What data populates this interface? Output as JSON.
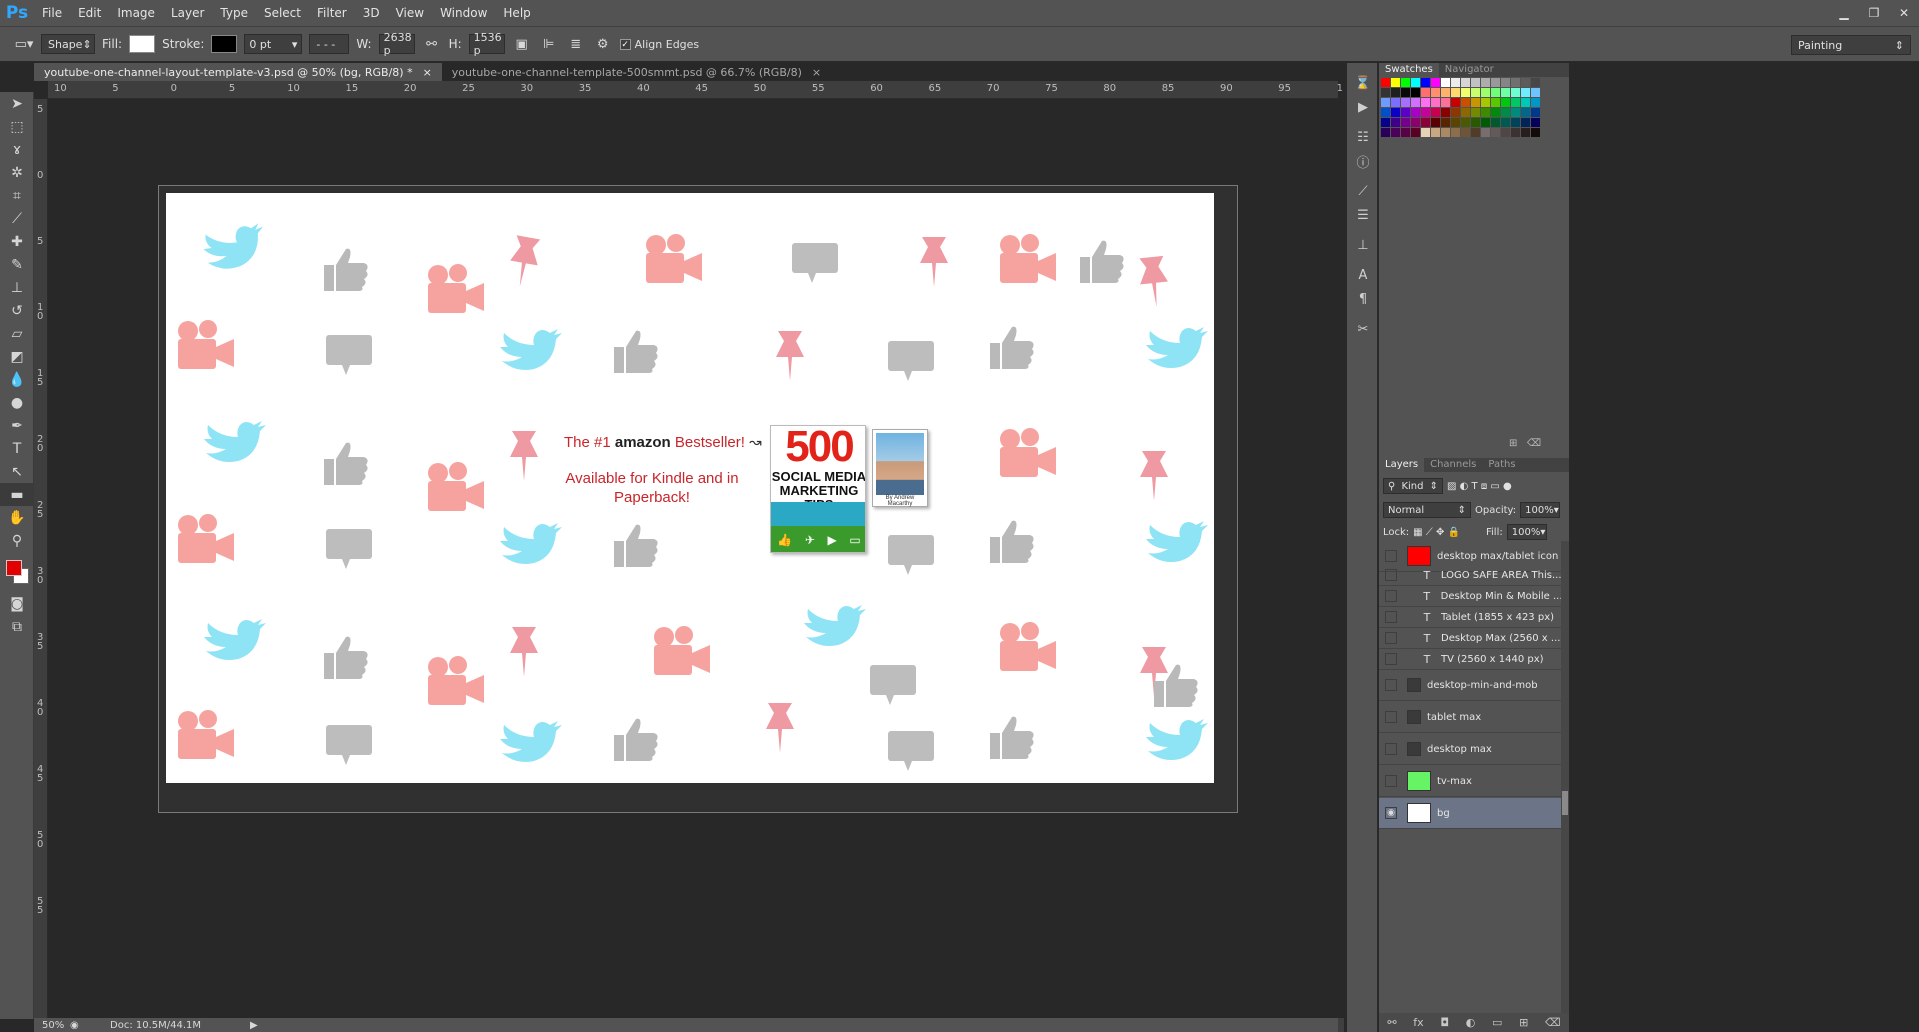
{
  "app": {
    "logo": "Ps"
  },
  "menu": [
    "File",
    "Edit",
    "Image",
    "Layer",
    "Type",
    "Select",
    "Filter",
    "3D",
    "View",
    "Window",
    "Help"
  ],
  "window_controls": {
    "minimize": "▁",
    "restore": "❐",
    "close": "✕"
  },
  "options": {
    "mode": "Shape",
    "fill_label": "Fill:",
    "fill_color": "#ffffff",
    "stroke_label": "Stroke:",
    "stroke_color": "#000000",
    "stroke_width": "0 pt",
    "w_label": "W:",
    "w_value": "2638 p",
    "h_label": "H:",
    "h_value": "1536 p",
    "align_edges_label": "Align Edges",
    "align_edges_checked": true,
    "workspace": "Painting"
  },
  "tabs": [
    {
      "label": "youtube-one-channel-layout-template-v3.psd @ 50% (bg, RGB/8) *",
      "close": "×",
      "active": true
    },
    {
      "label": "youtube-one-channel-template-500smmt.psd @ 66.7% (RGB/8)",
      "close": "×",
      "active": false
    }
  ],
  "ruler_h": [
    "10",
    "5",
    "0",
    "5",
    "10",
    "15",
    "20",
    "25",
    "30",
    "35",
    "40",
    "45",
    "50",
    "55",
    "60",
    "65",
    "70",
    "75",
    "80",
    "85",
    "90",
    "95",
    "1"
  ],
  "ruler_v": [
    "5",
    "0",
    "5",
    "1 0",
    "1 5",
    "2 0",
    "2 5",
    "3 0",
    "3 5",
    "4 0",
    "4 5",
    "5 0",
    "5 5"
  ],
  "canvas": {
    "promo_prefix": "The #1",
    "promo_amazon": "amazon",
    "promo_suffix": "Bestseller!",
    "promo_line2": "Available for Kindle and in Paperback!",
    "book_number": "500",
    "book_title": "SOCIAL MEDIA MARKETING TIPS",
    "author_caption": "By Andrew Macarthy",
    "colors": {
      "twitter": "#8ee3f5",
      "camera": "#f6a3a0",
      "pin": "#ef9aa2",
      "thumb": "#b9b9b9",
      "bubble": "#bdbdbd"
    }
  },
  "status": {
    "zoom": "50%",
    "doc": "Doc: 10.5M/44.1M"
  },
  "swatches": {
    "tabs": [
      "Swatches",
      "Navigator"
    ],
    "rows": [
      [
        "#ff0000",
        "#ffff00",
        "#00ff00",
        "#00ffff",
        "#0000ff",
        "#ff00ff",
        "#ffffff",
        "#ebebeb",
        "#d6d6d6",
        "#c2c2c2",
        "#adadad",
        "#999999",
        "#858585",
        "#707070",
        "#5c5c5c",
        "#474747"
      ],
      [
        "#333333",
        "#1f1f1f",
        "#0a0a0a",
        "#000000",
        "#ff6f6f",
        "#ff8f6f",
        "#ffb36f",
        "#ffd86f",
        "#f1ff6f",
        "#c9ff6f",
        "#9eff6f",
        "#6fff7a",
        "#6fffa7",
        "#6fffd2",
        "#6fecff",
        "#6fc4ff"
      ],
      [
        "#6f9aff",
        "#7a6fff",
        "#a66fff",
        "#d26fff",
        "#ff6ff1",
        "#ff6fc6",
        "#ff6f9b",
        "#c80000",
        "#c85000",
        "#c89600",
        "#a7c800",
        "#5ac800",
        "#00c810",
        "#00c866",
        "#00c8b6",
        "#0096c8"
      ],
      [
        "#0050c8",
        "#0a00c8",
        "#5a00c8",
        "#a700c8",
        "#c8009c",
        "#c8004f",
        "#8b0000",
        "#8b3800",
        "#8b6900",
        "#748b00",
        "#3f8b00",
        "#008b0b",
        "#008b47",
        "#008b7f",
        "#00698b",
        "#00388b"
      ],
      [
        "#07008b",
        "#3e008b",
        "#74008b",
        "#8b006d",
        "#8b0037",
        "#5a0000",
        "#5a2400",
        "#5a4400",
        "#4b5a00",
        "#295a00",
        "#005a07",
        "#005a2e",
        "#005a52",
        "#00445a",
        "#00245a",
        "#05005a"
      ],
      [
        "#28005a",
        "#4b005a",
        "#5a0047",
        "#5a0024",
        "#e6d2b4",
        "#c8a882",
        "#aa8a64",
        "#8c6e4b",
        "#6e5537",
        "#503c28",
        "#786e6e",
        "#645a5a",
        "#504646",
        "#3c3232",
        "#281e1e",
        "#140a0a"
      ]
    ]
  },
  "layers": {
    "tabs": [
      "Layers",
      "Channels",
      "Paths"
    ],
    "kind": "Kind",
    "blend": "Normal",
    "opacity_label": "Opacity:",
    "opacity": "100%",
    "lock_label": "Lock:",
    "fill_label": "Fill:",
    "fill": "100%",
    "items": [
      {
        "name": "desktop max/tablet icon",
        "type": "shape",
        "color": "#ff0000"
      },
      {
        "name": "LOGO SAFE AREA  This...",
        "type": "text"
      },
      {
        "name": "Desktop Min & Mobile  ...",
        "type": "text"
      },
      {
        "name": "Tablet  (1855 x 423 px)",
        "type": "text"
      },
      {
        "name": "Desktop Max  (2560 x ...",
        "type": "text"
      },
      {
        "name": "TV (2560 x 1440 px)",
        "type": "text"
      },
      {
        "name": "desktop-min-and-mob",
        "type": "group"
      },
      {
        "name": "tablet max",
        "type": "group"
      },
      {
        "name": "desktop max",
        "type": "group"
      },
      {
        "name": "tv-max",
        "type": "shape",
        "color": "#66f466"
      },
      {
        "name": "bg",
        "type": "shape",
        "color": "#ffffff",
        "selected": true,
        "visible": true
      }
    ]
  }
}
